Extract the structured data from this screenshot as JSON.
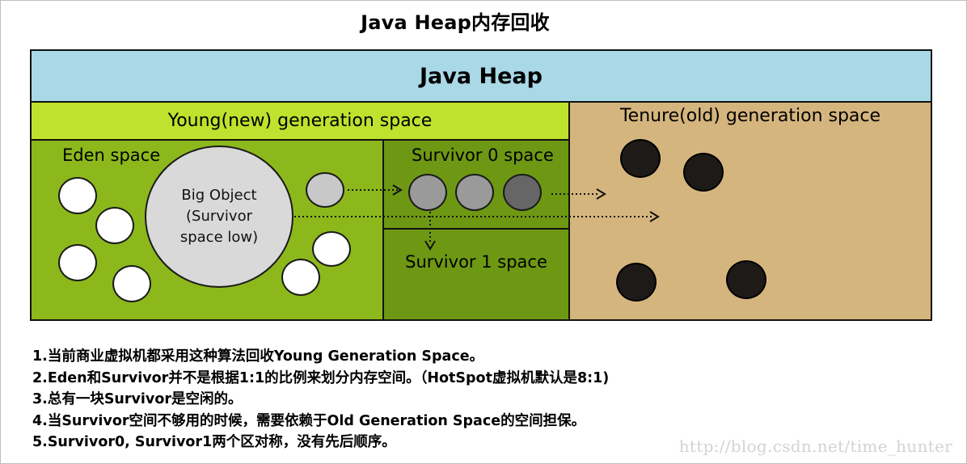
{
  "title": "Java Heap内存回收",
  "heap": {
    "banner": "Java Heap",
    "young_label": "Young(new) generation space",
    "eden_label": "Eden space",
    "big_object_label": "Big Object\n(Survivor\nspace low)",
    "survivor0_label": "Survivor 0 space",
    "survivor1_label": "Survivor 1 space",
    "tenure_label": "Tenure(old) generation space"
  },
  "notes": [
    "1.当前商业虚拟机都采用这种算法回收Young Generation Space。",
    "2.Eden和Survivor并不是根据1:1的比例来划分内存空间。（HotSpot虚拟机默认是8:1)",
    "3.总有一块Survivor是空闲的。",
    "4.当Survivor空间不够用的时候，需要依赖于Old Generation Space的空间担保。",
    "5.Survivor0, Survivor1两个区对称，没有先后顺序。"
  ],
  "watermark": "http://blog.csdn.net/time_hunter",
  "colors": {
    "heap_banner": "#a9d8e6",
    "young_band": "#bfe22e",
    "eden": "#8cb81c",
    "survivor": "#6e9813",
    "tenure": "#d5b57e",
    "tenured_object": "#1e1a17"
  }
}
